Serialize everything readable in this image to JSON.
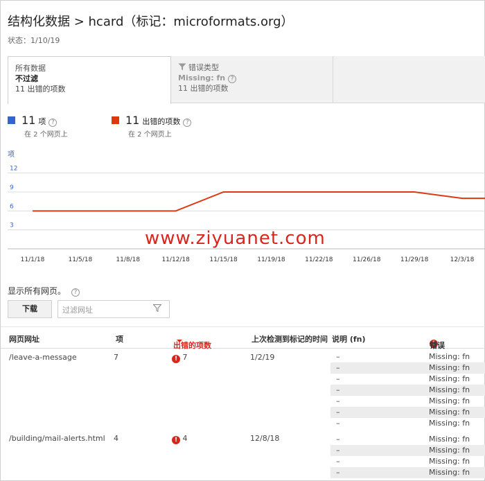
{
  "header": {
    "title": "结构化数据 > hcard（标记：microformats.org）",
    "status": "状态：1/10/19"
  },
  "filters": {
    "active": {
      "label": "所有数据",
      "value": "不过滤",
      "count": "11 出错的项数"
    },
    "error_type": {
      "label": "错误类型",
      "value": "Missing: fn",
      "count": "11 出错的项数"
    }
  },
  "legend": [
    {
      "value": "11",
      "unit": "项",
      "pages": "在 2 个网页上",
      "color": "#3366cc"
    },
    {
      "value": "11",
      "unit": "出错的项数",
      "pages": "在 2 个网页上",
      "color": "#dc3912"
    }
  ],
  "chart_data": {
    "type": "line",
    "ylabel": "项",
    "yticks": [
      "12",
      "9",
      "6",
      "3"
    ],
    "ylim": [
      0,
      13.5
    ],
    "categories": [
      "11/1/18",
      "11/5/18",
      "11/8/18",
      "11/12/18",
      "11/15/18",
      "11/19/18",
      "11/22/18",
      "11/26/18",
      "11/29/18",
      "12/3/18"
    ],
    "series": [
      {
        "color": "#dc3912",
        "values": [
          6,
          6,
          6,
          6,
          9,
          9,
          9,
          9,
          9,
          8
        ]
      }
    ]
  },
  "watermark": "www.ziyuanet.com",
  "table_controls": {
    "show_all": "显示所有网页。",
    "download": "下载",
    "filter_placeholder": "过滤网址"
  },
  "table": {
    "headers": {
      "url": "网页网址",
      "items": "项",
      "error_items": "出错的项数",
      "last_detected": "上次检测到标记的时间",
      "description": "说明 (fn)",
      "error": "错误"
    },
    "rows": [
      {
        "url": "/leave-a-message",
        "items": "7",
        "errors": "7",
        "date": "1/2/19",
        "subrows": [
          {
            "desc": "–",
            "err": "Missing: fn"
          },
          {
            "desc": "–",
            "err": "Missing: fn"
          },
          {
            "desc": "–",
            "err": "Missing: fn"
          },
          {
            "desc": "–",
            "err": "Missing: fn"
          },
          {
            "desc": "–",
            "err": "Missing: fn"
          },
          {
            "desc": "–",
            "err": "Missing: fn"
          },
          {
            "desc": "–",
            "err": "Missing: fn"
          }
        ]
      },
      {
        "url": "/building/mail-alerts.html",
        "items": "4",
        "errors": "4",
        "date": "12/8/18",
        "subrows": [
          {
            "desc": "–",
            "err": "Missing: fn"
          },
          {
            "desc": "–",
            "err": "Missing: fn"
          },
          {
            "desc": "–",
            "err": "Missing: fn"
          },
          {
            "desc": "–",
            "err": "Missing: fn"
          }
        ]
      }
    ]
  }
}
